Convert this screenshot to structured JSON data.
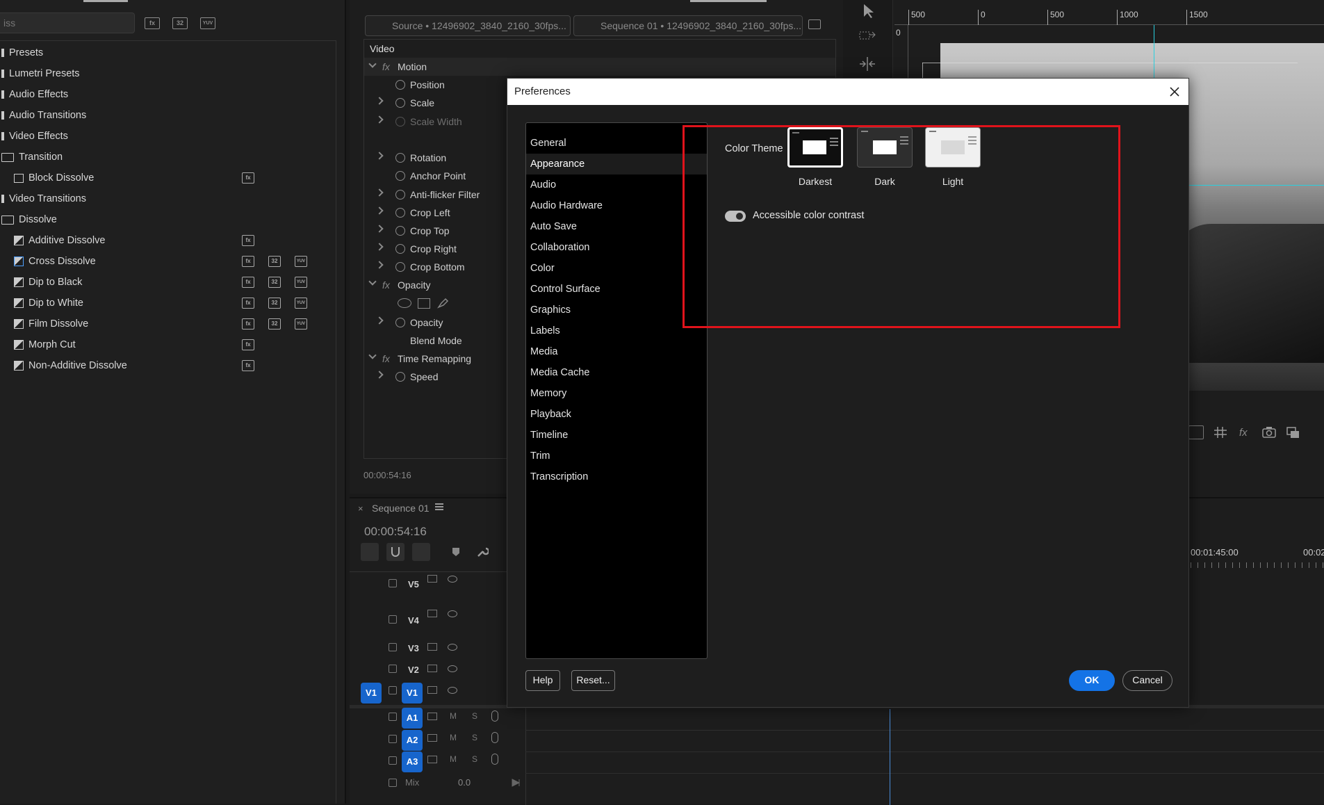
{
  "effects_panel": {
    "search_value": "iss",
    "toolbar_badges": [
      "accel-icon",
      "32-bit-icon",
      "yuv-icon"
    ],
    "items": [
      {
        "label": "Presets",
        "icon": "star-bin-icon"
      },
      {
        "label": "Lumetri Presets",
        "icon": "star-bin-icon"
      },
      {
        "label": "Audio Effects",
        "icon": "folder-icon"
      },
      {
        "label": "Audio Transitions",
        "icon": "folder-icon"
      },
      {
        "label": "Video Effects",
        "icon": "folder-icon"
      },
      {
        "label": "Transition",
        "icon": "folder-icon"
      },
      {
        "label": "Block Dissolve",
        "icon": "effect-icon"
      },
      {
        "label": "Video Transitions",
        "icon": "folder-icon"
      },
      {
        "label": "Dissolve",
        "icon": "folder-icon"
      },
      {
        "label": "Additive Dissolve",
        "icon": "transition-icon"
      },
      {
        "label": "Cross Dissolve",
        "icon": "transition-icon"
      },
      {
        "label": "Dip to Black",
        "icon": "transition-icon"
      },
      {
        "label": "Dip to White",
        "icon": "transition-icon"
      },
      {
        "label": "Film Dissolve",
        "icon": "transition-icon"
      },
      {
        "label": "Morph Cut",
        "icon": "transition-icon"
      },
      {
        "label": "Non-Additive Dissolve",
        "icon": "transition-icon"
      }
    ],
    "badge_text": {
      "accel": "fx",
      "b32": "32",
      "yuv": "YUV"
    }
  },
  "effect_controls": {
    "source_tab": "Source • 12496902_3840_2160_30fps...",
    "sequence_tab": "Sequence 01 • 12496902_3840_2160_30fps...",
    "section": "Video",
    "rows": {
      "motion": "Motion",
      "position": "Position",
      "scale": "Scale",
      "scale_width": "Scale Width",
      "rotation": "Rotation",
      "anchor_point": "Anchor Point",
      "anti_flicker": "Anti-flicker Filter",
      "crop_left": "Crop Left",
      "crop_top": "Crop Top",
      "crop_right": "Crop Right",
      "crop_bottom": "Crop Bottom",
      "opacity_fx": "Opacity",
      "opacity": "Opacity",
      "blend_mode": "Blend Mode",
      "time_remapping": "Time Remapping",
      "speed": "Speed"
    },
    "fx": "fx",
    "timecode": "00:00:54:16"
  },
  "timeline": {
    "title": "Sequence 01",
    "close": "×",
    "timecode": "00:00:54:16",
    "ruler_time": "00:01:45:00",
    "ruler_time_2": "00:02",
    "video_tracks": [
      "V5",
      "V4",
      "V3",
      "V2",
      "V1"
    ],
    "source_patch": "V1",
    "audio_tracks": [
      "A1",
      "A2",
      "A3"
    ],
    "mute": "M",
    "solo": "S",
    "mix_label": "Mix",
    "mix_value": "0.0"
  },
  "program_monitor": {
    "ruler_labels": [
      "500",
      "0",
      "500",
      "1000",
      "1500"
    ],
    "vertical_ruler": "0"
  },
  "preferences": {
    "title": "Preferences",
    "categories": [
      "General",
      "Appearance",
      "Audio",
      "Audio Hardware",
      "Auto Save",
      "Collaboration",
      "Color",
      "Control Surface",
      "Graphics",
      "Labels",
      "Media",
      "Media Cache",
      "Memory",
      "Playback",
      "Timeline",
      "Trim",
      "Transcription"
    ],
    "selected": "Appearance",
    "color_theme_label": "Color Theme",
    "themes": [
      {
        "name": "Darkest",
        "selected": true,
        "color": "#0f0f0f"
      },
      {
        "name": "Dark",
        "selected": false,
        "color": "#2e2e2e"
      },
      {
        "name": "Light",
        "selected": false,
        "color": "#f0f0f0"
      }
    ],
    "accessible_contrast_label": "Accessible color contrast",
    "accessible_contrast_on": true,
    "help_button": "Help",
    "reset_button": "Reset...",
    "ok_button": "OK",
    "cancel_button": "Cancel",
    "highlight_color": "#e0131b"
  },
  "accent_color": "#1473e6"
}
